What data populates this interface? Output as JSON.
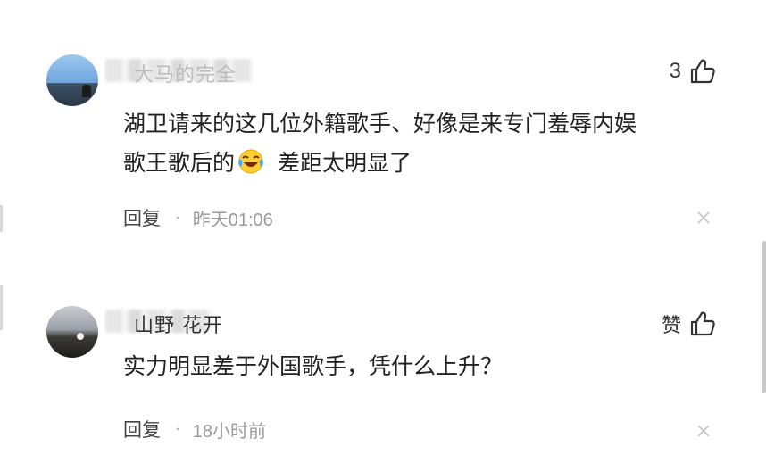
{
  "comments": [
    {
      "username": "大马的完全",
      "likes": "3",
      "text_line1": "湖卫请来的这几位外籍歌手、好像是来专门羞辱内娱",
      "text_line2_before": "歌王歌后的",
      "emoji": "laughing-crying-emoji",
      "text_line2_after": " 差距太明显了",
      "reply_label": "回复",
      "separator": "·",
      "time": "昨天01:06"
    },
    {
      "username": "山野 花开",
      "likes": "赞",
      "text": "实力明显差于外国歌手，凭什么上升？",
      "reply_label": "回复",
      "separator": "·",
      "time": "18小时前"
    }
  ]
}
